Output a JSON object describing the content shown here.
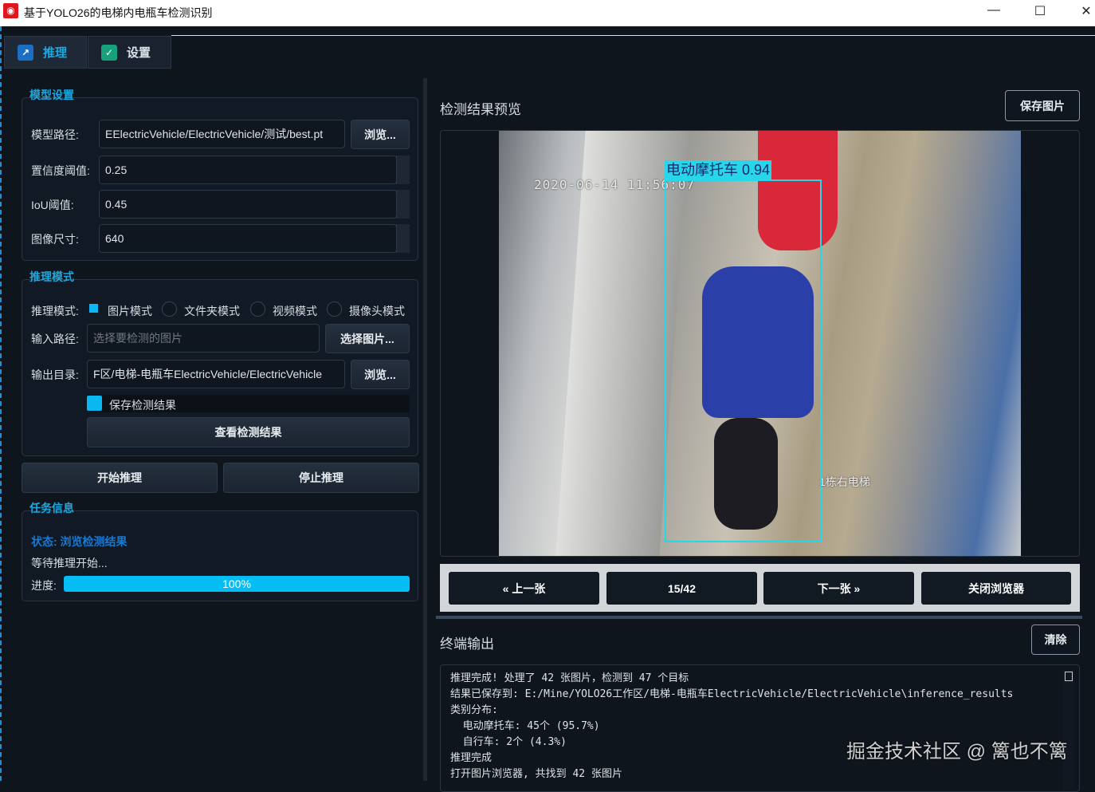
{
  "window": {
    "title": "基于YOLO26的电梯内电瓶车检测识别",
    "controls": [
      "minimize",
      "maximize",
      "close"
    ]
  },
  "tabs": [
    {
      "label": "推理",
      "icon": "chart-icon",
      "active": true
    },
    {
      "label": "设置",
      "icon": "check-icon",
      "active": false
    }
  ],
  "model_settings": {
    "title": "模型设置",
    "model_path_label": "模型路径:",
    "model_path": "EElectricVehicle/ElectricVehicle/测试/best.pt",
    "browse": "浏览...",
    "conf_label": "置信度阈值:",
    "conf": "0.25",
    "iou_label": "IoU阈值:",
    "iou": "0.45",
    "imgsz_label": "图像尺寸:",
    "imgsz": "640"
  },
  "inference_mode": {
    "title": "推理模式",
    "mode_label": "推理模式:",
    "modes": [
      {
        "label": "图片模式",
        "selected": true
      },
      {
        "label": "文件夹模式",
        "selected": false
      },
      {
        "label": "视频模式",
        "selected": false
      },
      {
        "label": "摄像头模式",
        "selected": false
      }
    ],
    "input_label": "输入路径:",
    "input_placeholder": "选择要检测的图片",
    "select_image": "选择图片...",
    "output_label": "输出目录:",
    "output_path": "F区/电梯-电瓶车ElectricVehicle/ElectricVehicle",
    "browse": "浏览...",
    "save_results_label": "保存检测结果",
    "save_results": true,
    "view_results": "查看检测结果"
  },
  "actions": {
    "start": "开始推理",
    "stop": "停止推理"
  },
  "task_info": {
    "title": "任务信息",
    "status": "状态: 浏览检测结果",
    "message": "等待推理开始...",
    "progress_label": "进度:",
    "progress": 100,
    "progress_text": "100%"
  },
  "preview": {
    "title": "检测结果预览",
    "save_image": "保存图片",
    "timestamp": "2020-06-14 11:56:07",
    "caption": "1栋右电梯",
    "detection": {
      "label": "电动摩托车 0.94",
      "color": "#27d6e8"
    }
  },
  "navigator": {
    "prev": "« 上一张",
    "counter": "15/42",
    "next": "下一张 »",
    "close": "关闭浏览器"
  },
  "terminal": {
    "title": "终端输出",
    "clear": "清除",
    "lines": [
      "推理完成! 处理了 42 张图片，检测到 47 个目标",
      "结果已保存到: E:/Mine/YOLO26工作区/电梯-电瓶车ElectricVehicle/ElectricVehicle\\inference_results",
      "类别分布:",
      "  电动摩托车: 45个 (95.7%)",
      "  自行车: 2个 (4.3%)",
      "推理完成",
      "打开图片浏览器, 共找到 42 张图片"
    ]
  },
  "watermark": "掘金技术社区 @ 篱也不篱"
}
